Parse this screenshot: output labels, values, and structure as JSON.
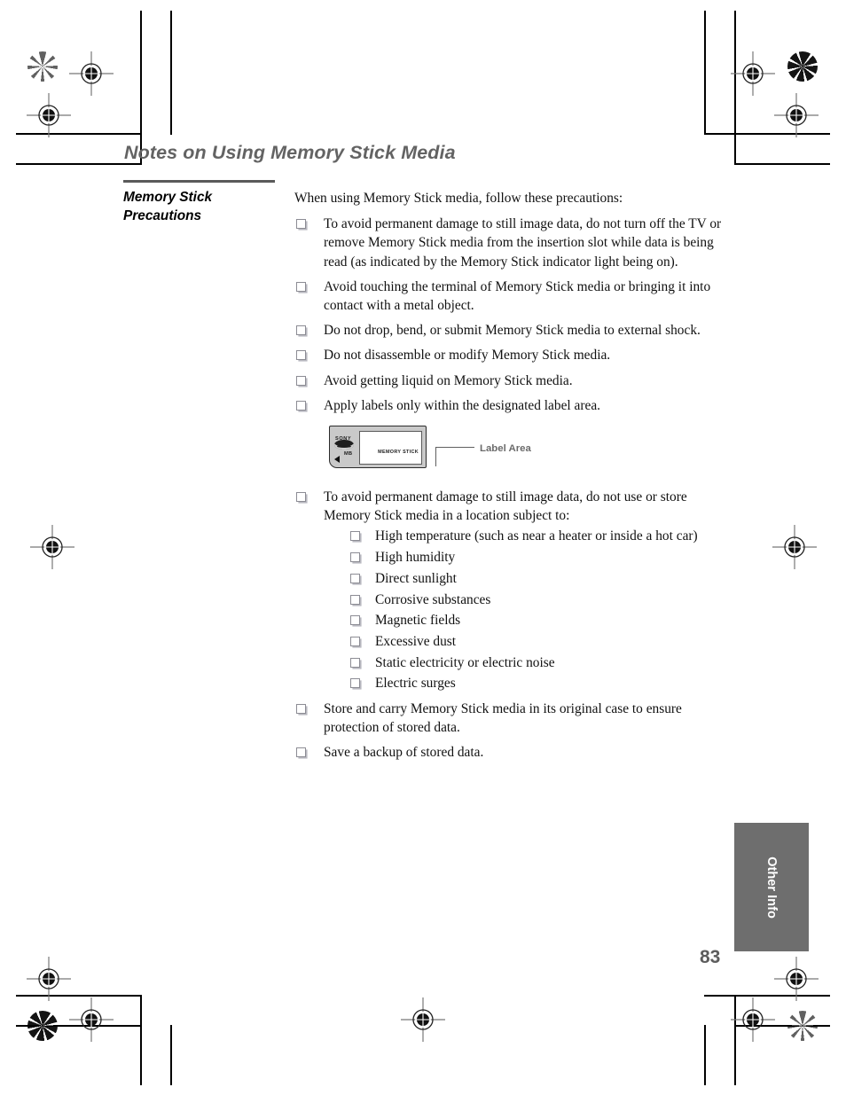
{
  "page": {
    "title": "Notes on Using Memory Stick Media",
    "folio": "83",
    "section_tab": "Other Info"
  },
  "sidebar": {
    "heading": "Memory Stick Precautions"
  },
  "content": {
    "intro": "When using Memory Stick media, follow these precautions:",
    "bullets": [
      "To avoid permanent damage to still image data, do not turn off the TV or remove Memory Stick media from the insertion slot while data is being read (as indicated by the Memory Stick indicator light being on).",
      "Avoid touching the terminal of Memory Stick media or bringing it into contact with a metal object.",
      "Do not drop, bend, or submit Memory Stick media to external shock.",
      "Do not disassemble or modify Memory Stick media.",
      "Avoid getting liquid on Memory Stick media.",
      "Apply labels only within the designated label area."
    ],
    "location_bullet": "To avoid permanent damage to still image data, do not use or store Memory Stick media in a location subject to:",
    "location_sublist": [
      "High temperature (such as near a heater or inside a hot car)",
      "High humidity",
      "Direct sunlight",
      "Corrosive substances",
      "Magnetic fields",
      "Excessive dust",
      "Static electricity or electric noise",
      "Electric surges"
    ],
    "closing_bullets": [
      "Store and carry Memory Stick media in its original case to ensure protection of stored data.",
      "Save a backup of stored data."
    ]
  },
  "figure": {
    "brand": "SONY",
    "capacity_label": "MB",
    "media_label": "MEMORY STICK",
    "caption": "Label Area"
  },
  "colors": {
    "title_gray": "#636363",
    "tab_gray": "#6e6e6e",
    "folio_gray": "#5d5d5d",
    "card_body": "#c9c9c9"
  }
}
